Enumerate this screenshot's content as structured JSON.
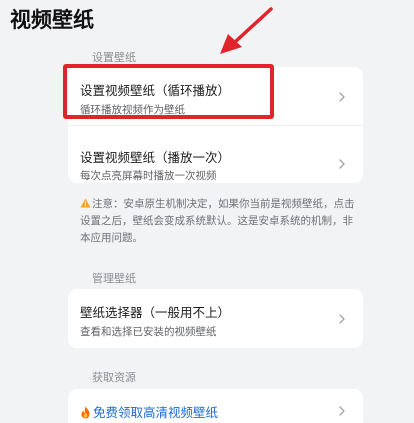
{
  "page": {
    "title": "视频壁纸"
  },
  "sections": {
    "set_wallpaper": "设置壁纸",
    "manage_wallpaper": "管理壁纸",
    "get_resources": "获取资源"
  },
  "items": {
    "loop": {
      "title": "设置视频壁纸（循环播放）",
      "subtitle": "循环播放视频作为壁纸"
    },
    "once": {
      "title": "设置视频壁纸（播放一次）",
      "subtitle": "每次点亮屏幕时播放一次视频"
    },
    "selector": {
      "title": "壁纸选择器（一般用不上）",
      "subtitle": "查看和选择已安装的视频壁纸"
    },
    "free": {
      "title": "免费领取高清视频壁纸"
    }
  },
  "notice": {
    "text": "注意：安卓原生机制决定，如果你当前是视频壁纸，点击设置之后，壁纸会变成系统默认。这是安卓系统的机制，非本应用问题。"
  },
  "colors": {
    "background": "#f2f3f5",
    "card": "#ffffff",
    "highlight": "#e0242b",
    "link": "#1a6ad8",
    "warning": "#f5a623",
    "fire": "#ff6a00"
  },
  "icons": {
    "chevron": "chevron-right-icon",
    "warning": "warning-icon",
    "fire": "fire-icon",
    "annotation_arrow": "red-arrow"
  }
}
